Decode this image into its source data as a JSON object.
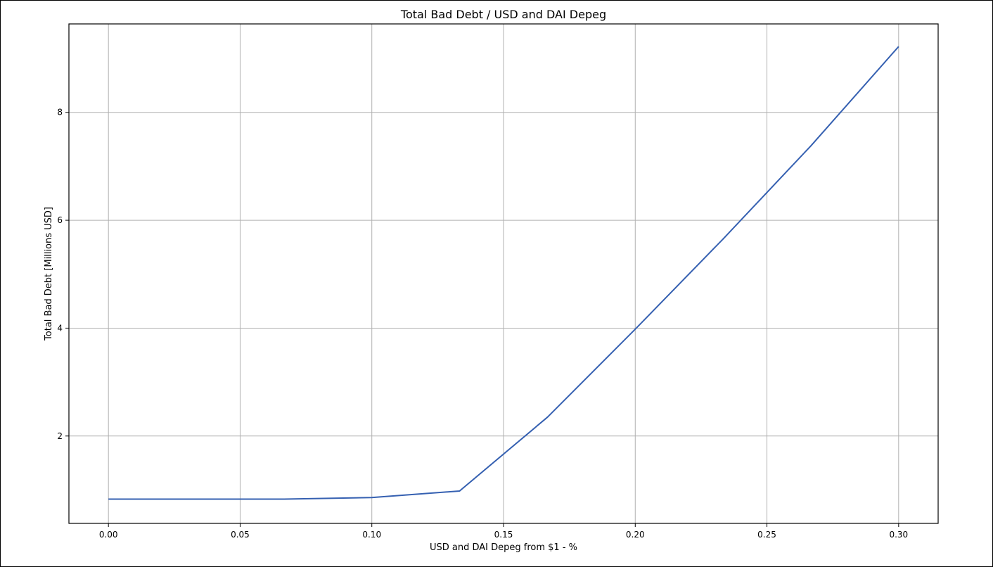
{
  "chart_data": {
    "type": "line",
    "title": "Total Bad Debt / USD and DAI Depeg",
    "xlabel": "USD and DAI Depeg from $1 - %",
    "ylabel": "Total Bad Debt [Millions USD]",
    "xlim": [
      -0.015,
      0.315
    ],
    "ylim": [
      0.38,
      9.64
    ],
    "xticks": [
      0.0,
      0.05,
      0.1,
      0.15,
      0.2,
      0.25,
      0.3
    ],
    "xtick_labels": [
      "0.00",
      "0.05",
      "0.10",
      "0.15",
      "0.20",
      "0.25",
      "0.30"
    ],
    "yticks": [
      2,
      4,
      6,
      8
    ],
    "ytick_labels": [
      "2",
      "4",
      "6",
      "8"
    ],
    "grid": true,
    "series": [
      {
        "color": "#3560b1",
        "x": [
          0.0,
          0.0333,
          0.0667,
          0.1,
          0.1333,
          0.1667,
          0.2,
          0.2333,
          0.2667,
          0.3
        ],
        "y": [
          0.83,
          0.83,
          0.83,
          0.86,
          0.98,
          2.35,
          3.98,
          5.65,
          7.38,
          9.22
        ]
      }
    ]
  }
}
